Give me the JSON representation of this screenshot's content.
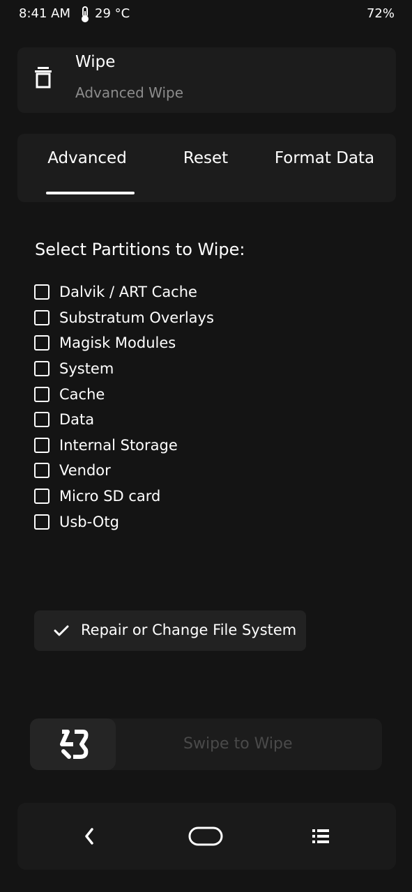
{
  "status_bar": {
    "time": "8:41 AM",
    "temperature": "29 °C",
    "battery": "72%"
  },
  "header": {
    "icon": "trash-icon",
    "title": "Wipe",
    "subtitle": "Advanced Wipe"
  },
  "tabs": [
    {
      "label": "Advanced",
      "selected": true
    },
    {
      "label": "Reset",
      "selected": false
    },
    {
      "label": "Format Data",
      "selected": false
    }
  ],
  "section_title": "Select Partitions to Wipe:",
  "partitions": [
    {
      "label": "Dalvik / ART Cache",
      "checked": false
    },
    {
      "label": "Substratum Overlays",
      "checked": false
    },
    {
      "label": "Magisk Modules",
      "checked": false
    },
    {
      "label": "System",
      "checked": false
    },
    {
      "label": "Cache",
      "checked": false
    },
    {
      "label": "Data",
      "checked": false
    },
    {
      "label": "Internal Storage",
      "checked": false
    },
    {
      "label": "Vendor",
      "checked": false
    },
    {
      "label": "Micro SD card",
      "checked": false
    },
    {
      "label": "Usb-Otg",
      "checked": false
    }
  ],
  "repair_button": {
    "icon": "check-icon",
    "label": "Repair or Change File System"
  },
  "swipe": {
    "icon": "logo-icon",
    "label": "Swipe to Wipe"
  },
  "nav": {
    "back_icon": "back-icon",
    "home_icon": "home-icon",
    "menu_icon": "menu-icon"
  }
}
